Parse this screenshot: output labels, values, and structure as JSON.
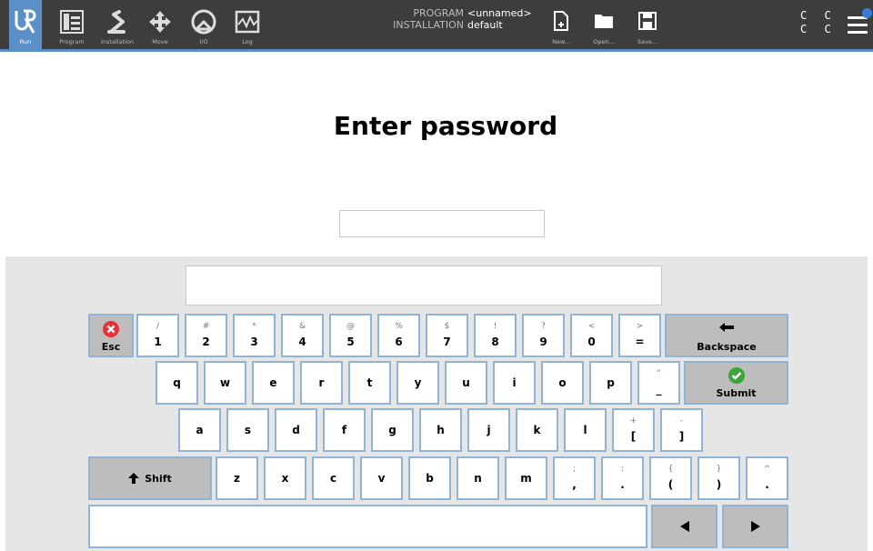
{
  "topbar": {
    "nav": [
      {
        "label": "Run",
        "icon": "ur-logo-icon"
      },
      {
        "label": "Program",
        "icon": "program-tree-icon"
      },
      {
        "label": "Installation",
        "icon": "robot-arm-icon"
      },
      {
        "label": "Move",
        "icon": "move-arrows-icon"
      },
      {
        "label": "I/O",
        "icon": "io-gauge-icon"
      },
      {
        "label": "Log",
        "icon": "log-waveform-icon"
      }
    ],
    "program_key": "PROGRAM",
    "program_value": "<unnamed>",
    "installation_key": "INSTALLATION",
    "installation_value": "default",
    "file": [
      {
        "label": "New...",
        "icon": "new-file-icon"
      },
      {
        "label": "Open...",
        "icon": "folder-icon"
      },
      {
        "label": "Save...",
        "icon": "save-disk-icon"
      }
    ],
    "status_row1": "C C",
    "status_row2": "C C",
    "menu_icon": "hamburger-menu-icon",
    "accent_color": "#5b8fc7"
  },
  "dialog": {
    "title": "Enter password",
    "password_value": ""
  },
  "keyboard": {
    "display_value": "",
    "esc_label": "Esc",
    "backspace_label": "Backspace",
    "submit_label": "Submit",
    "shift_label": "Shift",
    "space_value": "",
    "row1": [
      {
        "sub": "/",
        "main": "1"
      },
      {
        "sub": "#",
        "main": "2"
      },
      {
        "sub": "*",
        "main": "3"
      },
      {
        "sub": "&",
        "main": "4"
      },
      {
        "sub": "@",
        "main": "5"
      },
      {
        "sub": "%",
        "main": "6"
      },
      {
        "sub": "$",
        "main": "7"
      },
      {
        "sub": "!",
        "main": "8"
      },
      {
        "sub": "?",
        "main": "9"
      },
      {
        "sub": "<",
        "main": "0"
      },
      {
        "sub": ">",
        "main": "="
      }
    ],
    "row2": [
      {
        "main": "q"
      },
      {
        "main": "w"
      },
      {
        "main": "e"
      },
      {
        "main": "r"
      },
      {
        "main": "t"
      },
      {
        "main": "y"
      },
      {
        "main": "u"
      },
      {
        "main": "i"
      },
      {
        "main": "o"
      },
      {
        "main": "p"
      },
      {
        "sub": "\"",
        "main": "_"
      }
    ],
    "row3": [
      {
        "main": "a"
      },
      {
        "main": "s"
      },
      {
        "main": "d"
      },
      {
        "main": "f"
      },
      {
        "main": "g"
      },
      {
        "main": "h"
      },
      {
        "main": "j"
      },
      {
        "main": "k"
      },
      {
        "main": "l"
      },
      {
        "sub": "+",
        "main": "["
      },
      {
        "sub": "-",
        "main": "]"
      }
    ],
    "row4": [
      {
        "main": "z"
      },
      {
        "main": "x"
      },
      {
        "main": "c"
      },
      {
        "main": "v"
      },
      {
        "main": "b"
      },
      {
        "main": "n"
      },
      {
        "main": "m"
      },
      {
        "sub": ";",
        "main": ","
      },
      {
        "sub": ":",
        "main": "."
      },
      {
        "sub": "{",
        "main": "("
      },
      {
        "sub": "}",
        "main": ")"
      },
      {
        "sub": "^",
        "main": "."
      }
    ]
  }
}
